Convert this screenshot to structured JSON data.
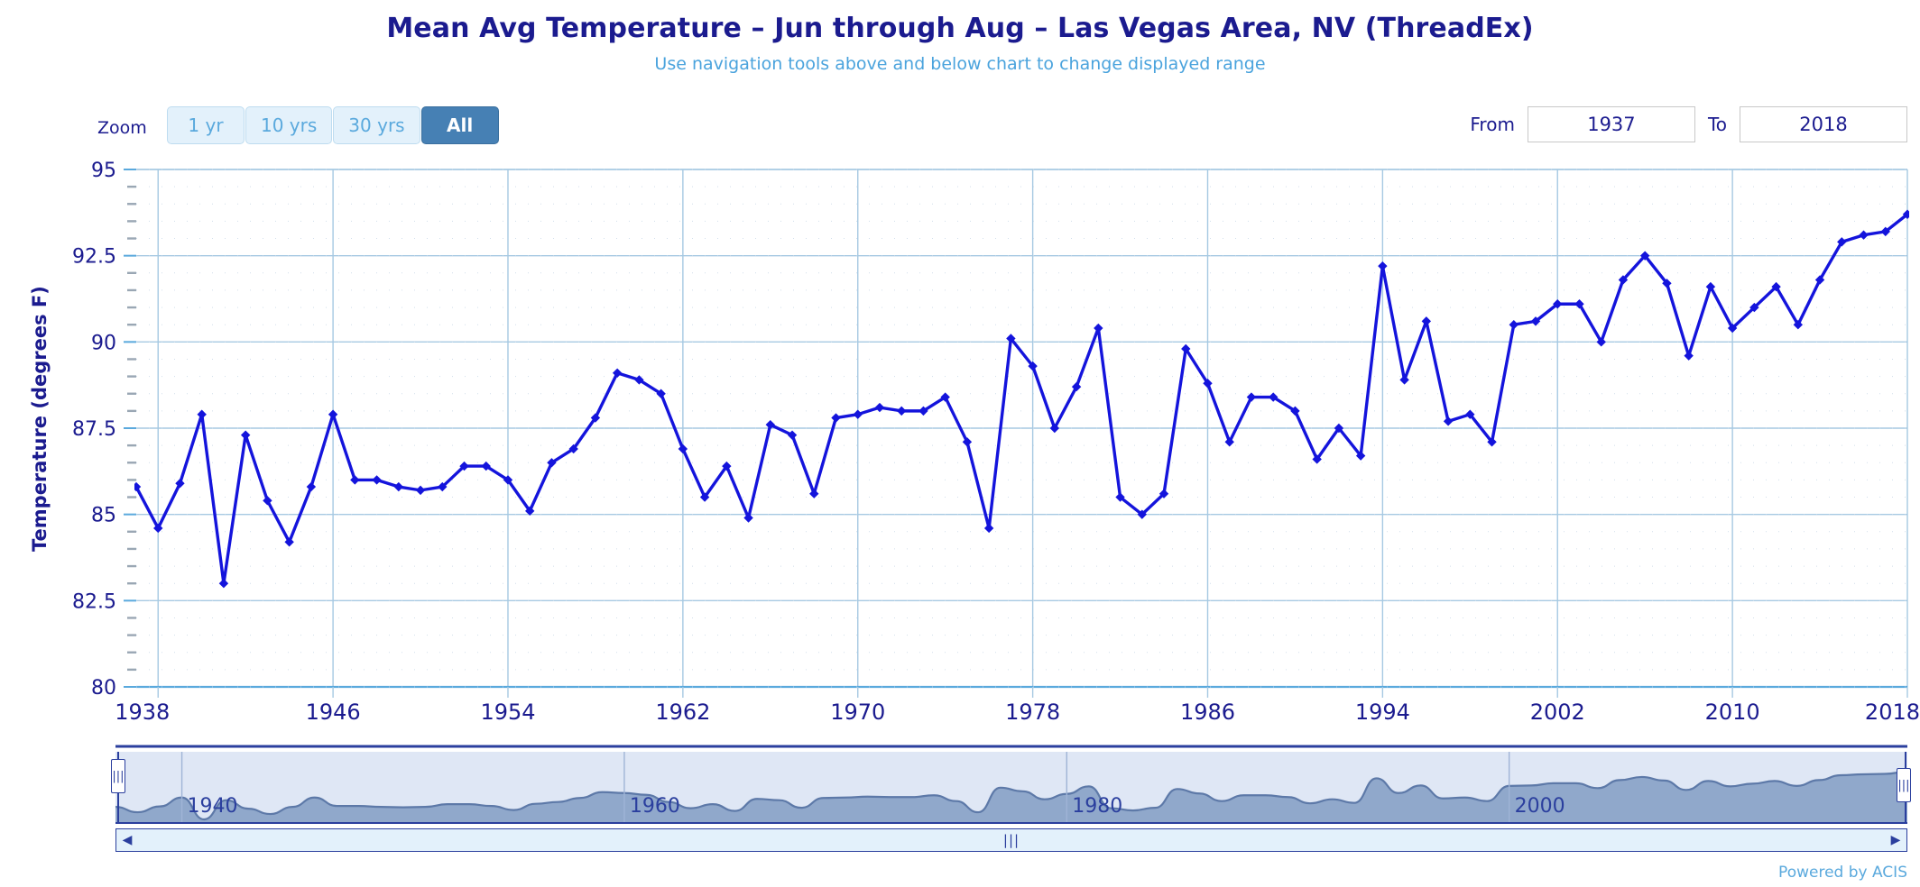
{
  "header": {
    "title": "Mean Avg Temperature – Jun through Aug – Las Vegas Area, NV (ThreadEx)",
    "subtitle": "Use navigation tools above and below chart to change displayed range"
  },
  "range_selector": {
    "zoom_label": "Zoom",
    "buttons": [
      {
        "label": "1 yr",
        "active": false
      },
      {
        "label": "10 yrs",
        "active": false
      },
      {
        "label": "30 yrs",
        "active": false
      },
      {
        "label": "All",
        "active": true
      }
    ],
    "from_label": "From",
    "from_value": "1937",
    "to_label": "To",
    "to_value": "2018"
  },
  "navigator": {
    "tick_labels": [
      "1940",
      "1960",
      "1980",
      "2000"
    ],
    "left_handle_grip": "|||",
    "right_handle_grip": "|||",
    "scroll_left_icon": "◀",
    "scroll_right_icon": "▶",
    "scroll_grip": "|||"
  },
  "credit": {
    "text": "Powered by ACIS"
  },
  "colors": {
    "title": "#1b1b8f",
    "subtitle": "#4aa3dd",
    "series": "#1414dc",
    "grid": "#a6c9e2",
    "axis": "#5aa9dd",
    "accent": "#4680b4",
    "navigator_area": "#7f9fc8"
  },
  "chart_data": {
    "type": "line",
    "title": "Mean Avg Temperature – Jun through Aug – Las Vegas Area, NV (ThreadEx)",
    "subtitle": "Use navigation tools above and below chart to change displayed range",
    "xlabel": "",
    "ylabel": "Temperature (degrees F)",
    "xlim": [
      1937,
      2018
    ],
    "ylim": [
      80,
      95
    ],
    "yticks": [
      80,
      82.5,
      85,
      87.5,
      90,
      92.5,
      95
    ],
    "ytick_labels": [
      "80",
      "82.5",
      "85",
      "87.5",
      "90",
      "92.5",
      "95"
    ],
    "xticks": [
      1938,
      1946,
      1954,
      1962,
      1970,
      1978,
      1986,
      1994,
      2002,
      2010,
      2018
    ],
    "xtick_labels": [
      "1938",
      "1946",
      "1954",
      "1962",
      "1970",
      "1978",
      "1986",
      "1994",
      "2002",
      "2010",
      "2018"
    ],
    "grid": true,
    "legend": false,
    "marker": "diamond",
    "x": [
      1937,
      1938,
      1939,
      1940,
      1941,
      1942,
      1943,
      1944,
      1945,
      1946,
      1947,
      1948,
      1949,
      1950,
      1951,
      1952,
      1953,
      1954,
      1955,
      1956,
      1957,
      1958,
      1959,
      1960,
      1961,
      1962,
      1963,
      1964,
      1965,
      1966,
      1967,
      1968,
      1969,
      1970,
      1971,
      1972,
      1973,
      1974,
      1975,
      1976,
      1977,
      1978,
      1979,
      1980,
      1981,
      1982,
      1983,
      1984,
      1985,
      1986,
      1987,
      1988,
      1989,
      1990,
      1991,
      1992,
      1993,
      1994,
      1995,
      1996,
      1997,
      1998,
      1999,
      2000,
      2001,
      2002,
      2003,
      2004,
      2005,
      2006,
      2007,
      2008,
      2009,
      2010,
      2011,
      2012,
      2013,
      2014,
      2015,
      2016,
      2017,
      2018
    ],
    "y": [
      85.8,
      84.6,
      85.9,
      87.9,
      83.0,
      87.3,
      85.4,
      84.2,
      85.8,
      87.9,
      86.0,
      86.0,
      85.8,
      85.7,
      85.8,
      86.4,
      86.4,
      86.0,
      85.1,
      86.5,
      86.9,
      87.8,
      89.1,
      88.9,
      88.5,
      86.9,
      85.5,
      86.4,
      84.9,
      87.6,
      87.3,
      85.6,
      87.8,
      87.9,
      88.1,
      88.0,
      88.0,
      88.4,
      87.1,
      84.6,
      90.1,
      89.3,
      87.5,
      88.7,
      90.4,
      85.5,
      85.0,
      85.6,
      89.8,
      88.8,
      87.1,
      88.4,
      88.4,
      88.0,
      86.6,
      87.5,
      86.7,
      92.2,
      88.9,
      90.6,
      87.7,
      87.9,
      87.1,
      90.5,
      90.6,
      91.1,
      91.1,
      90.0,
      91.8,
      92.5,
      91.7,
      89.6,
      91.6,
      90.4,
      91.0,
      91.6,
      90.5,
      91.8,
      92.9,
      93.1,
      93.2,
      93.7
    ],
    "series_name": "Mean Avg Temperature"
  }
}
